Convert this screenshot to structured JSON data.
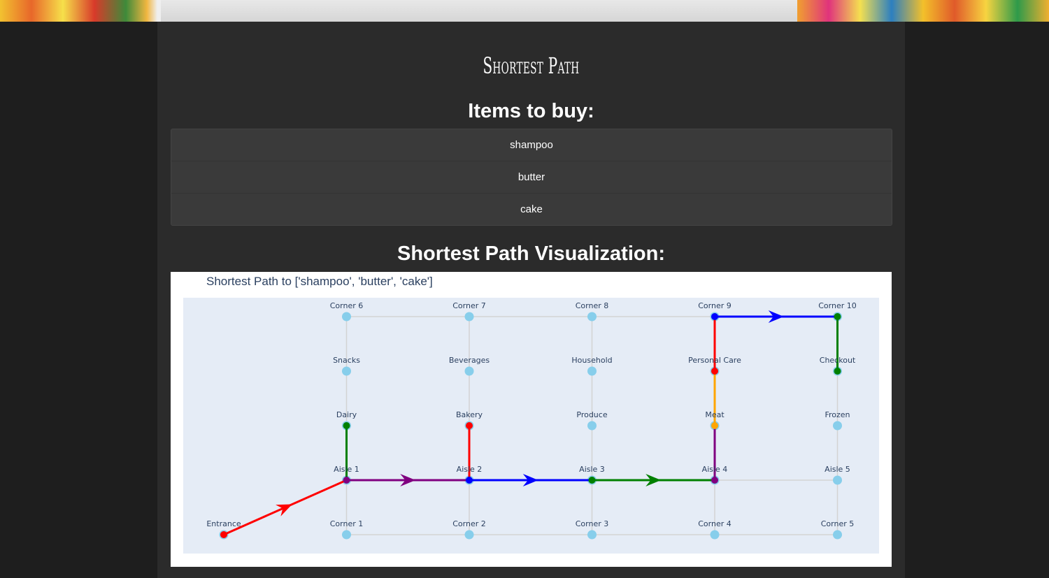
{
  "app": {
    "title": "Shortest Path",
    "items_heading": "Items to buy:",
    "viz_heading": "Shortest Path Visualization:"
  },
  "items": [
    "shampoo",
    "butter",
    "cake"
  ],
  "chart_data": {
    "type": "network",
    "title": "Shortest Path to ['shampoo', 'butter', 'cake']",
    "node_color": "#87ceeb",
    "edge_color": "#d3d3d3",
    "background": "#e5ecf6",
    "nodes": [
      {
        "id": "Entrance",
        "x": -1,
        "y": 1
      },
      {
        "id": "Corner 6",
        "x": 0,
        "y": 5
      },
      {
        "id": "Corner 7",
        "x": 1,
        "y": 5
      },
      {
        "id": "Corner 8",
        "x": 2,
        "y": 5
      },
      {
        "id": "Corner 9",
        "x": 3,
        "y": 5
      },
      {
        "id": "Corner 10",
        "x": 4,
        "y": 5
      },
      {
        "id": "Snacks",
        "x": 0,
        "y": 4
      },
      {
        "id": "Beverages",
        "x": 1,
        "y": 4
      },
      {
        "id": "Household",
        "x": 2,
        "y": 4
      },
      {
        "id": "Personal Care",
        "x": 3,
        "y": 4
      },
      {
        "id": "Checkout",
        "x": 4,
        "y": 4
      },
      {
        "id": "Dairy",
        "x": 0,
        "y": 3
      },
      {
        "id": "Bakery",
        "x": 1,
        "y": 3
      },
      {
        "id": "Produce",
        "x": 2,
        "y": 3
      },
      {
        "id": "Meat",
        "x": 3,
        "y": 3
      },
      {
        "id": "Frozen",
        "x": 4,
        "y": 3
      },
      {
        "id": "Aisle 1",
        "x": 0,
        "y": 2
      },
      {
        "id": "Aisle 2",
        "x": 1,
        "y": 2
      },
      {
        "id": "Aisle 3",
        "x": 2,
        "y": 2
      },
      {
        "id": "Aisle 4",
        "x": 3,
        "y": 2
      },
      {
        "id": "Aisle 5",
        "x": 4,
        "y": 2
      },
      {
        "id": "Corner 1",
        "x": 0,
        "y": 1
      },
      {
        "id": "Corner 2",
        "x": 1,
        "y": 1
      },
      {
        "id": "Corner 3",
        "x": 2,
        "y": 1
      },
      {
        "id": "Corner 4",
        "x": 3,
        "y": 1
      },
      {
        "id": "Corner 5",
        "x": 4,
        "y": 1
      }
    ],
    "edges": [
      [
        "Corner 6",
        "Corner 7"
      ],
      [
        "Corner 7",
        "Corner 8"
      ],
      [
        "Corner 8",
        "Corner 9"
      ],
      [
        "Corner 9",
        "Corner 10"
      ],
      [
        "Corner 1",
        "Corner 2"
      ],
      [
        "Corner 2",
        "Corner 3"
      ],
      [
        "Corner 3",
        "Corner 4"
      ],
      [
        "Corner 4",
        "Corner 5"
      ],
      [
        "Corner 6",
        "Snacks"
      ],
      [
        "Snacks",
        "Dairy"
      ],
      [
        "Dairy",
        "Aisle 1"
      ],
      [
        "Aisle 1",
        "Corner 1"
      ],
      [
        "Corner 7",
        "Beverages"
      ],
      [
        "Beverages",
        "Bakery"
      ],
      [
        "Bakery",
        "Aisle 2"
      ],
      [
        "Aisle 2",
        "Corner 2"
      ],
      [
        "Corner 8",
        "Household"
      ],
      [
        "Household",
        "Produce"
      ],
      [
        "Produce",
        "Aisle 3"
      ],
      [
        "Aisle 3",
        "Corner 3"
      ],
      [
        "Corner 9",
        "Personal Care"
      ],
      [
        "Personal Care",
        "Meat"
      ],
      [
        "Meat",
        "Aisle 4"
      ],
      [
        "Aisle 4",
        "Corner 4"
      ],
      [
        "Corner 10",
        "Checkout"
      ],
      [
        "Checkout",
        "Frozen"
      ],
      [
        "Frozen",
        "Aisle 5"
      ],
      [
        "Aisle 5",
        "Corner 5"
      ],
      [
        "Entrance",
        "Aisle 1"
      ],
      [
        "Aisle 1",
        "Aisle 2"
      ],
      [
        "Aisle 2",
        "Aisle 3"
      ],
      [
        "Aisle 3",
        "Aisle 4"
      ],
      [
        "Aisle 4",
        "Aisle 5"
      ]
    ],
    "path_segments": [
      {
        "from": "Entrance",
        "to": "Aisle 1",
        "color": "#ff0000",
        "arrow": true
      },
      {
        "from": "Aisle 1",
        "to": "Dairy",
        "color": "#008000",
        "arrow": false
      },
      {
        "from": "Aisle 1",
        "to": "Aisle 2",
        "color": "#800080",
        "arrow": true
      },
      {
        "from": "Aisle 2",
        "to": "Bakery",
        "color": "#ff0000",
        "arrow": false
      },
      {
        "from": "Aisle 2",
        "to": "Aisle 3",
        "color": "#0000ff",
        "arrow": true
      },
      {
        "from": "Aisle 3",
        "to": "Aisle 4",
        "color": "#008000",
        "arrow": true
      },
      {
        "from": "Aisle 4",
        "to": "Meat",
        "color": "#800080",
        "arrow": false
      },
      {
        "from": "Meat",
        "to": "Personal Care",
        "color": "#ffa500",
        "arrow": false
      },
      {
        "from": "Personal Care",
        "to": "Corner 9",
        "color": "#ff0000",
        "arrow": false
      },
      {
        "from": "Corner 9",
        "to": "Corner 10",
        "color": "#0000ff",
        "arrow": true
      },
      {
        "from": "Corner 10",
        "to": "Checkout",
        "color": "#008000",
        "arrow": false
      }
    ],
    "highlighted_nodes": [
      {
        "id": "Entrance",
        "color": "#ff0000"
      },
      {
        "id": "Aisle 1",
        "color": "#800080"
      },
      {
        "id": "Dairy",
        "color": "#008000"
      },
      {
        "id": "Aisle 2",
        "color": "#0000ff"
      },
      {
        "id": "Bakery",
        "color": "#ff0000"
      },
      {
        "id": "Aisle 3",
        "color": "#008000"
      },
      {
        "id": "Aisle 4",
        "color": "#800080"
      },
      {
        "id": "Meat",
        "color": "#ffa500"
      },
      {
        "id": "Personal Care",
        "color": "#ff0000"
      },
      {
        "id": "Corner 9",
        "color": "#0000ff"
      },
      {
        "id": "Corner 10",
        "color": "#008000"
      },
      {
        "id": "Checkout",
        "color": "#008000"
      }
    ]
  }
}
